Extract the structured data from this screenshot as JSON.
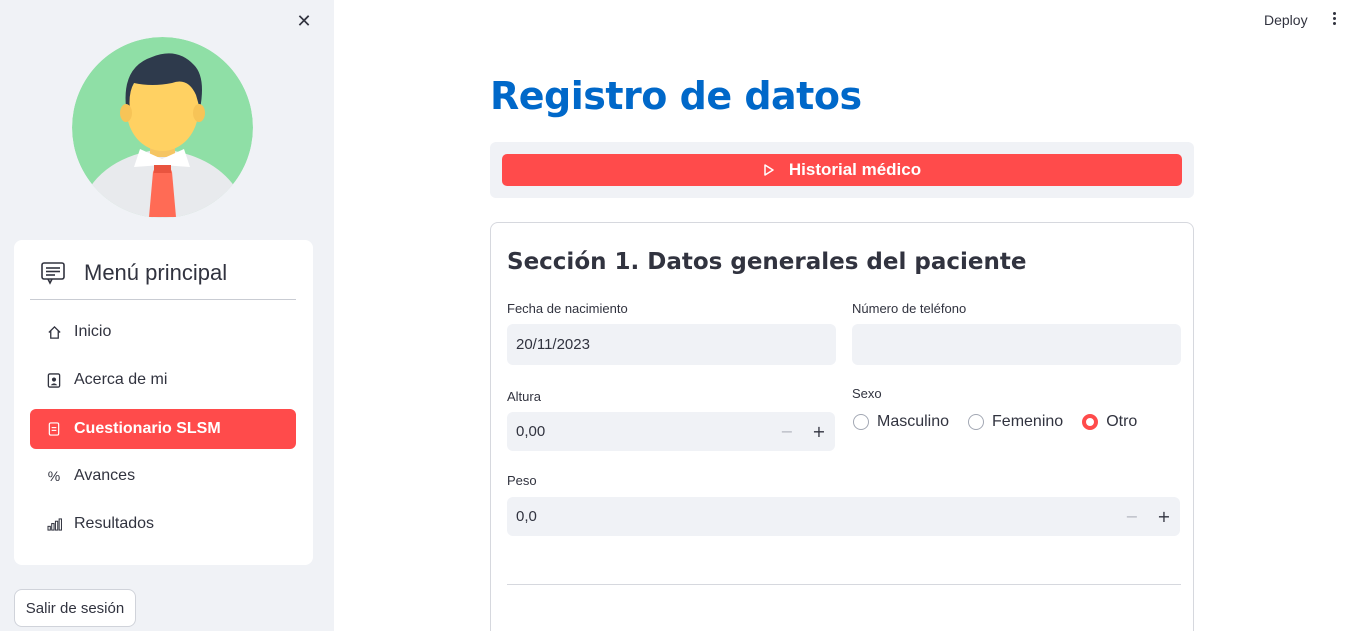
{
  "sidebar": {
    "close_icon": "close-icon",
    "menu_title": "Menú principal",
    "items": [
      {
        "label": "Inicio",
        "icon": "house-icon",
        "active": false
      },
      {
        "label": "Acerca de mi",
        "icon": "person-badge-icon",
        "active": false
      },
      {
        "label": "Cuestionario SLSM",
        "icon": "clipboard-icon",
        "active": true
      },
      {
        "label": "Avances",
        "icon": "percent-icon",
        "active": false
      },
      {
        "label": "Resultados",
        "icon": "bar-chart-icon",
        "active": false
      }
    ],
    "logout_label": "Salir de sesión"
  },
  "topbar": {
    "deploy_label": "Deploy"
  },
  "main": {
    "title": "Registro de datos",
    "expander_button": "Historial médico",
    "section_title": "Sección 1. Datos generales del paciente",
    "fields": {
      "birthdate": {
        "label": "Fecha de nacimiento",
        "value": "20/11/2023"
      },
      "phone": {
        "label": "Número de teléfono",
        "value": ""
      },
      "height": {
        "label": "Altura",
        "value": "0,00"
      },
      "sex": {
        "label": "Sexo",
        "options": [
          "Masculino",
          "Femenino",
          "Otro"
        ],
        "selected": "Otro"
      },
      "weight": {
        "label": "Peso",
        "value": "0,0"
      }
    }
  },
  "colors": {
    "accent": "#ff4b4b",
    "title_blue": "#0068c9",
    "sidebar_bg": "#f0f2f6"
  }
}
